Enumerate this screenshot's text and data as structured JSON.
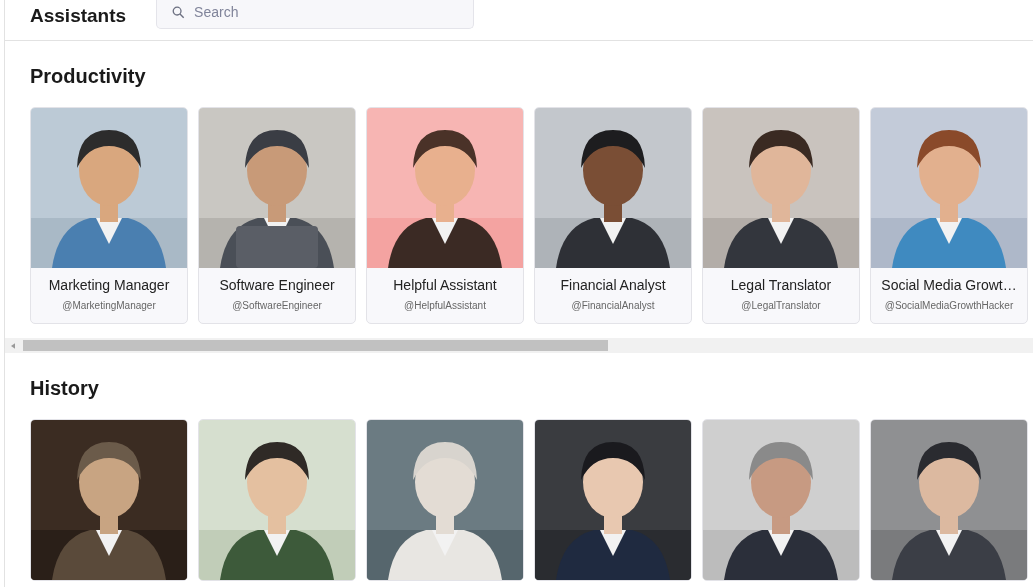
{
  "header": {
    "title": "Assistants",
    "search": {
      "placeholder": "Search"
    }
  },
  "sections": [
    {
      "title": "Productivity",
      "cards": [
        {
          "kind": "assistant",
          "name": "Marketing Manager",
          "handle": "@MarketingManager"
        },
        {
          "kind": "assistant",
          "name": "Software Engineer",
          "handle": "@SoftwareEngineer"
        },
        {
          "kind": "assistant",
          "name": "Helpful Assistant",
          "handle": "@HelpfulAssistant"
        },
        {
          "kind": "assistant",
          "name": "Financial Analyst",
          "handle": "@FinancialAnalyst"
        },
        {
          "kind": "assistant",
          "name": "Legal Translator",
          "handle": "@LegalTranslator"
        },
        {
          "kind": "assistant",
          "name": "Social Media Growt…",
          "handle": "@SocialMediaGrowthHacker"
        }
      ]
    },
    {
      "title": "History"
    }
  ]
}
